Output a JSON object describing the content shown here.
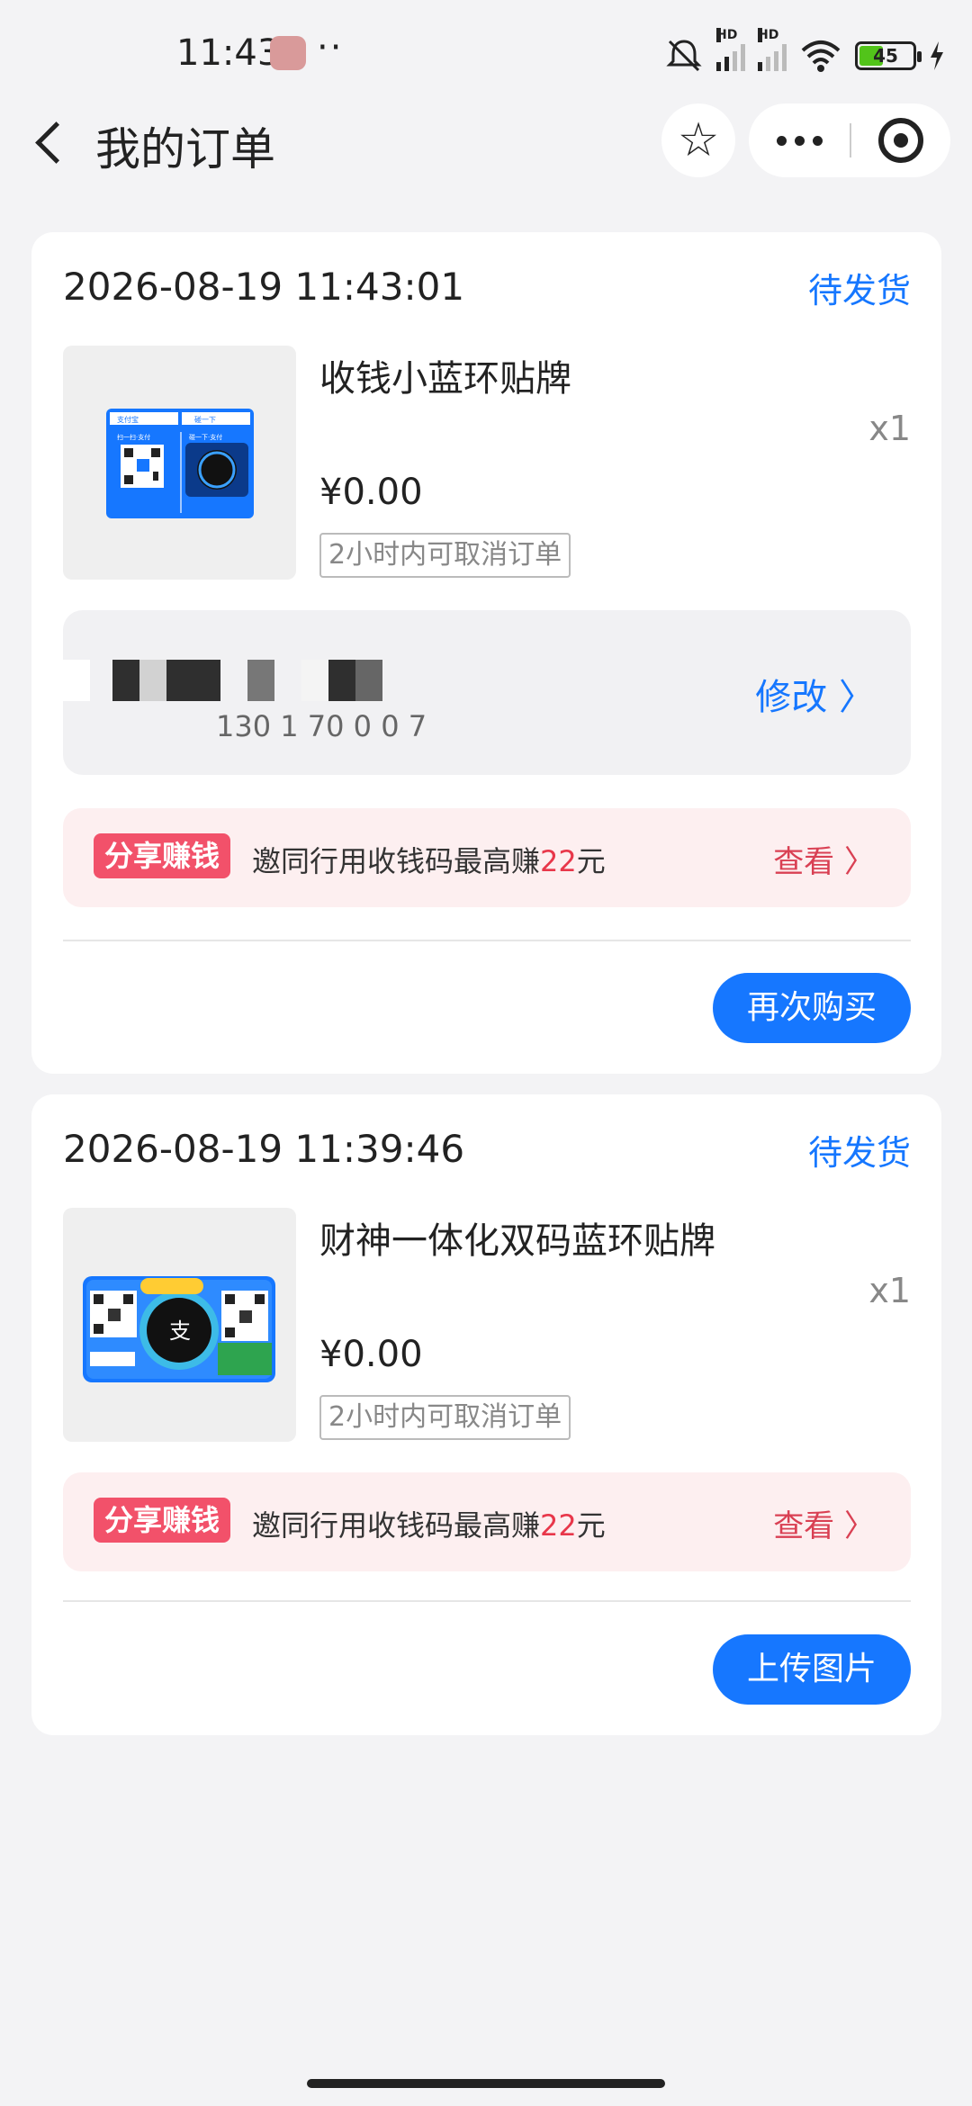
{
  "status_bar": {
    "time": "11:43",
    "dots": "··",
    "signal_label": "HD",
    "battery": "45",
    "battery_level": 0.45
  },
  "nav": {
    "title": "我的订单",
    "back_icon": "chevron-left-icon",
    "favorite_icon": "star-outline-icon",
    "favorite_glyph": "☆",
    "more_icon": "more-dots-icon",
    "close_icon": "close-target-icon"
  },
  "orders": [
    {
      "time": "2026-08-19 11:43:01",
      "status": "待发货",
      "product_name": "收钱小蓝环贴牌",
      "quantity": "x1",
      "price": "¥0.00",
      "cancel_tip": "2小时内可取消订单",
      "address": {
        "phone_partial": "130 1 70 0 0 7",
        "edit_label": "修改 〉"
      },
      "promo": {
        "tag": "分享赚钱",
        "text_prefix": "邀同行用收钱码最高赚",
        "amount": "22",
        "text_suffix": "元",
        "view_label": "查看 〉"
      },
      "action_label": "再次购买"
    },
    {
      "time": "2026-08-19 11:39:46",
      "status": "待发货",
      "product_name": "财神一体化双码蓝环贴牌",
      "quantity": "x1",
      "price": "¥0.00",
      "cancel_tip": "2小时内可取消订单",
      "promo": {
        "tag": "分享赚钱",
        "text_prefix": "邀同行用收钱码最高赚",
        "amount": "22",
        "text_suffix": "元",
        "view_label": "查看 〉"
      },
      "action_label": "上传图片"
    }
  ],
  "thumb1": {
    "left_label": "支付宝",
    "right_label": "碰一下",
    "left_caption": "扫一扫·支付",
    "right_caption": "碰一下·支付"
  },
  "colors": {
    "accent": "#1677ff",
    "promo_tag": "#f2516a",
    "promo_bg": "#fdeff0",
    "background": "#f3f3f5"
  }
}
